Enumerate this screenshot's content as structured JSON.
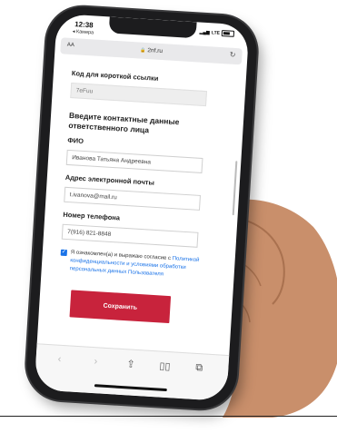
{
  "status_bar": {
    "time": "12:38",
    "back_app": "◂ Камера",
    "network": "LTE"
  },
  "browser": {
    "text_size_label": "AA",
    "url": "2nf.ru",
    "icons": [
      "lock-icon",
      "reload-icon",
      "back-icon",
      "forward-icon",
      "share-icon",
      "bookmarks-icon",
      "tabs-icon"
    ]
  },
  "form": {
    "short_code": {
      "label": "Код для короткой ссылки",
      "value": "7eFuu"
    },
    "section_title": "Введите контактные данные ответственного лица",
    "fio": {
      "label": "ФИО",
      "value": "Иванова Татьяна Андреевна"
    },
    "email": {
      "label": "Адрес электронной почты",
      "value": "t.ivanova@mail.ru"
    },
    "phone": {
      "label": "Номер телефона",
      "value": "7(916) 821-8848"
    },
    "consent": {
      "checked": true,
      "text": "Я ознакомлен(а) и выражаю согласие с ",
      "link": "Политикой конфиденциальности и условиями обработки персональных данных Пользователя"
    },
    "save_label": "Сохранить"
  },
  "colors": {
    "accent": "#c8233c",
    "link": "#1a73e8",
    "phone_body": "#1c1c1e"
  }
}
